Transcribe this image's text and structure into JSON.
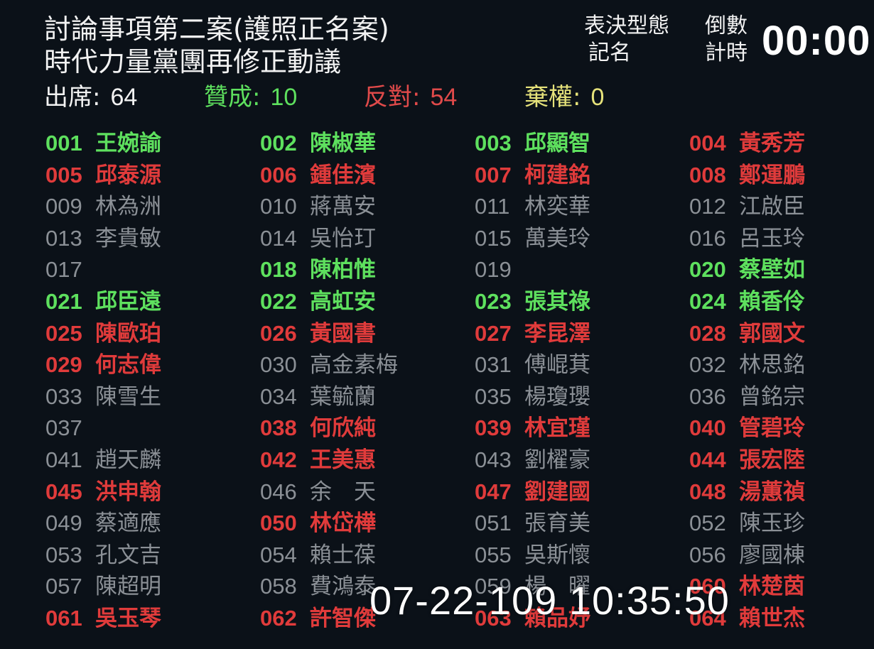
{
  "header": {
    "title_line1": "討論事項第二案(護照正名案)",
    "title_line2": "時代力量黨團再修正動議"
  },
  "vote_type": {
    "label": "表決型態",
    "value": "記名"
  },
  "countdown": {
    "label": "倒數計時",
    "value": "00:00"
  },
  "stats": {
    "present_label": "出席:",
    "present_value": "64",
    "yes_label": "贊成:",
    "yes_value": "10",
    "no_label": "反對:",
    "no_value": "54",
    "abstain_label": "棄權:",
    "abstain_value": "0"
  },
  "colors": {
    "yes": "#5ee05e",
    "no": "#e03b3b",
    "none": "#8b9096",
    "abstain": "#e6e27a",
    "background": "#0b1118"
  },
  "members": [
    {
      "seat": "001",
      "name": "王婉諭",
      "vote": "yes"
    },
    {
      "seat": "002",
      "name": "陳椒華",
      "vote": "yes"
    },
    {
      "seat": "003",
      "name": "邱顯智",
      "vote": "yes"
    },
    {
      "seat": "004",
      "name": "黃秀芳",
      "vote": "no"
    },
    {
      "seat": "005",
      "name": "邱泰源",
      "vote": "no"
    },
    {
      "seat": "006",
      "name": "鍾佳濱",
      "vote": "no"
    },
    {
      "seat": "007",
      "name": "柯建銘",
      "vote": "no"
    },
    {
      "seat": "008",
      "name": "鄭運鵬",
      "vote": "no"
    },
    {
      "seat": "009",
      "name": "林為洲",
      "vote": "none"
    },
    {
      "seat": "010",
      "name": "蔣萬安",
      "vote": "none"
    },
    {
      "seat": "011",
      "name": "林奕華",
      "vote": "none"
    },
    {
      "seat": "012",
      "name": "江啟臣",
      "vote": "none"
    },
    {
      "seat": "013",
      "name": "李貴敏",
      "vote": "none"
    },
    {
      "seat": "014",
      "name": "吳怡玎",
      "vote": "none"
    },
    {
      "seat": "015",
      "name": "萬美玲",
      "vote": "none"
    },
    {
      "seat": "016",
      "name": "呂玉玲",
      "vote": "none"
    },
    {
      "seat": "017",
      "name": "",
      "vote": "none"
    },
    {
      "seat": "018",
      "name": "陳柏惟",
      "vote": "yes"
    },
    {
      "seat": "019",
      "name": "",
      "vote": "none"
    },
    {
      "seat": "020",
      "name": "蔡壁如",
      "vote": "yes"
    },
    {
      "seat": "021",
      "name": "邱臣遠",
      "vote": "yes"
    },
    {
      "seat": "022",
      "name": "高虹安",
      "vote": "yes"
    },
    {
      "seat": "023",
      "name": "張其祿",
      "vote": "yes"
    },
    {
      "seat": "024",
      "name": "賴香伶",
      "vote": "yes"
    },
    {
      "seat": "025",
      "name": "陳歐珀",
      "vote": "no"
    },
    {
      "seat": "026",
      "name": "黃國書",
      "vote": "no"
    },
    {
      "seat": "027",
      "name": "李昆澤",
      "vote": "no"
    },
    {
      "seat": "028",
      "name": "郭國文",
      "vote": "no"
    },
    {
      "seat": "029",
      "name": "何志偉",
      "vote": "no"
    },
    {
      "seat": "030",
      "name": "高金素梅",
      "vote": "none"
    },
    {
      "seat": "031",
      "name": "傅崐萁",
      "vote": "none"
    },
    {
      "seat": "032",
      "name": "林思銘",
      "vote": "none"
    },
    {
      "seat": "033",
      "name": "陳雪生",
      "vote": "none"
    },
    {
      "seat": "034",
      "name": "葉毓蘭",
      "vote": "none"
    },
    {
      "seat": "035",
      "name": "楊瓊瓔",
      "vote": "none"
    },
    {
      "seat": "036",
      "name": "曾銘宗",
      "vote": "none"
    },
    {
      "seat": "037",
      "name": "",
      "vote": "none"
    },
    {
      "seat": "038",
      "name": "何欣純",
      "vote": "no"
    },
    {
      "seat": "039",
      "name": "林宜瑾",
      "vote": "no"
    },
    {
      "seat": "040",
      "name": "管碧玲",
      "vote": "no"
    },
    {
      "seat": "041",
      "name": "趙天麟",
      "vote": "none"
    },
    {
      "seat": "042",
      "name": "王美惠",
      "vote": "no"
    },
    {
      "seat": "043",
      "name": "劉櫂豪",
      "vote": "none"
    },
    {
      "seat": "044",
      "name": "張宏陸",
      "vote": "no"
    },
    {
      "seat": "045",
      "name": "洪申翰",
      "vote": "no"
    },
    {
      "seat": "046",
      "name": "余　天",
      "vote": "none"
    },
    {
      "seat": "047",
      "name": "劉建國",
      "vote": "no"
    },
    {
      "seat": "048",
      "name": "湯蕙禎",
      "vote": "no"
    },
    {
      "seat": "049",
      "name": "蔡適應",
      "vote": "none"
    },
    {
      "seat": "050",
      "name": "林岱樺",
      "vote": "no"
    },
    {
      "seat": "051",
      "name": "張育美",
      "vote": "none"
    },
    {
      "seat": "052",
      "name": "陳玉珍",
      "vote": "none"
    },
    {
      "seat": "053",
      "name": "孔文吉",
      "vote": "none"
    },
    {
      "seat": "054",
      "name": "賴士葆",
      "vote": "none"
    },
    {
      "seat": "055",
      "name": "吳斯懷",
      "vote": "none"
    },
    {
      "seat": "056",
      "name": "廖國棟",
      "vote": "none"
    },
    {
      "seat": "057",
      "name": "陳超明",
      "vote": "none"
    },
    {
      "seat": "058",
      "name": "費鴻泰",
      "vote": "none"
    },
    {
      "seat": "059",
      "name": "楊　曜",
      "vote": "none"
    },
    {
      "seat": "060",
      "name": "林楚茵",
      "vote": "no"
    },
    {
      "seat": "061",
      "name": "吳玉琴",
      "vote": "no"
    },
    {
      "seat": "062",
      "name": "許智傑",
      "vote": "no"
    },
    {
      "seat": "063",
      "name": "賴品妤",
      "vote": "no"
    },
    {
      "seat": "064",
      "name": "賴世杰",
      "vote": "no"
    }
  ],
  "timestamp": "07-22-109 10:35:50"
}
